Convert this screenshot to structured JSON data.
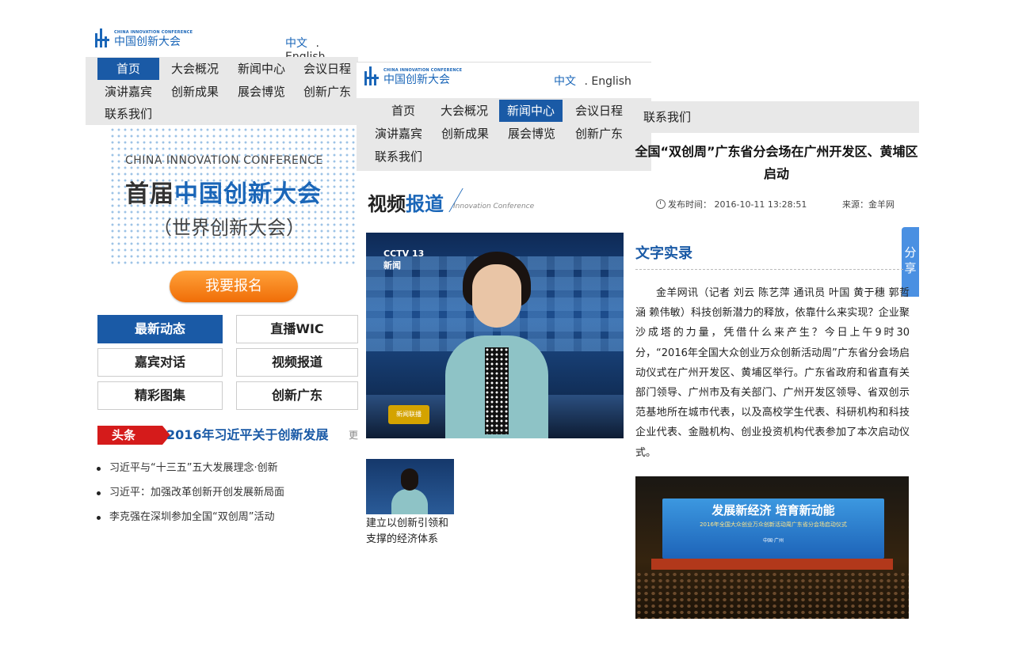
{
  "logo": {
    "en": "CHINA INNOVATION CONFERENCE",
    "cn": "中国创新大会"
  },
  "lang": {
    "cn": "中文",
    "en": ". English"
  },
  "nav": {
    "items": [
      "首页",
      "大会概况",
      "新闻中心",
      "会议日程",
      "演讲嘉宾",
      "创新成果",
      "展会博览",
      "创新广东",
      "联系我们"
    ]
  },
  "panel1": {
    "active_nav": "首页",
    "hero": {
      "en": "CHINA INNOVATION CONFERENCE",
      "cn_a": "首届",
      "cn_b": "中国创新大会",
      "sub": "（世界创新大会）"
    },
    "register_label": "我要报名",
    "grid": [
      "最新动态",
      "直播WIC",
      "嘉宾对话",
      "视频报道",
      "精彩图集",
      "创新广东"
    ],
    "headline": {
      "tag": "头条",
      "text": "2016年习近平关于创新发展",
      "more": "更"
    },
    "news": [
      "习近平与“十三五”五大发展理念·创新",
      "习近平：加强改革创新开创发展新局面",
      "李克强在深圳参加全国“双创周”活动"
    ]
  },
  "panel2": {
    "active_nav": "新闻中心",
    "section": {
      "a": "视频",
      "b": "报道",
      "en": "Innovation Conference"
    },
    "video": {
      "channel": "CCTV 13",
      "sub": "新闻",
      "badge": "新闻联播"
    },
    "thumb_caption": "建立以创新引领和支撑的经济体系"
  },
  "panel3": {
    "nav_item": "联系我们",
    "title": "全国“双创周”广东省分会场在广州开发区、黄埔区启动",
    "published": "发布时间： 2016-10-11 13:28:51",
    "source": "来源：金羊网",
    "share": "分享",
    "subtitle": "文字实录",
    "body": "金羊网讯（记者 刘云 陈艺萍 通讯员 叶国 黄于穗 郭哲涵 赖伟敏）科技创新潜力的释放，依靠什么来实现？企业聚沙成塔的力量，凭借什么来产生？今日上午9时30分，“2016年全国大众创业万众创新活动周”广东省分会场启动仪式在广州开发区、黄埔区举行。广东省政府和省直有关部门领导、广州市及有关部门、广州开发区领导、省双创示范基地所在城市代表，以及高校学生代表、科研机构和科技企业代表、金融机构、创业投资机构代表参加了本次启动仪式。",
    "photo": {
      "banner_title": "发展新经济 培育新动能",
      "banner_sub": "2016年全国大众创业万众创新活动周广东省分会场启动仪式",
      "banner_sub2": "中国·广州"
    }
  },
  "colors": {
    "brand_blue": "#1a5aa6",
    "accent_orange": "#f58a1f",
    "tag_red": "#d51b1b"
  }
}
